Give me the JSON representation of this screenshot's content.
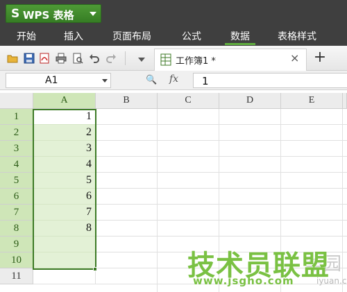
{
  "app": {
    "logo": "S",
    "title": "WPS 表格"
  },
  "ribbon": {
    "tabs": [
      {
        "label": "开始"
      },
      {
        "label": "插入"
      },
      {
        "label": "页面布局"
      },
      {
        "label": "公式"
      },
      {
        "label": "数据"
      },
      {
        "label": "表格样式"
      }
    ],
    "active_tab": "数据"
  },
  "quick_access": {
    "icons": [
      "open-folder-icon",
      "save-icon",
      "export-pdf-icon",
      "print-icon",
      "print-preview-icon",
      "undo-icon",
      "redo-icon",
      "dropdown-icon"
    ]
  },
  "document_tab": {
    "title": "工作簿1 *",
    "close": "×"
  },
  "new_tab": {
    "label": "+"
  },
  "formula_bar": {
    "name_box": "A1",
    "zoom_icon": "🔍",
    "fx": "fx",
    "value": "1"
  },
  "sheet": {
    "columns": [
      "A",
      "B",
      "C",
      "D",
      "E"
    ],
    "rows": [
      "1",
      "2",
      "3",
      "4",
      "5",
      "6",
      "7",
      "8",
      "9",
      "10",
      "11"
    ],
    "column_a_values": [
      "1",
      "2",
      "3",
      "4",
      "5",
      "6",
      "7",
      "8",
      "",
      "",
      ""
    ],
    "selected_range": "A1:A10"
  },
  "watermark": {
    "main": "技术员联盟",
    "side": "华园",
    "url": "www.jsgho.com",
    "side_url": "iyuan.com"
  },
  "colors": {
    "accent": "#3c7a25",
    "selection_fill": "#e3f1d6",
    "title_bar": "#3f3f3f"
  }
}
